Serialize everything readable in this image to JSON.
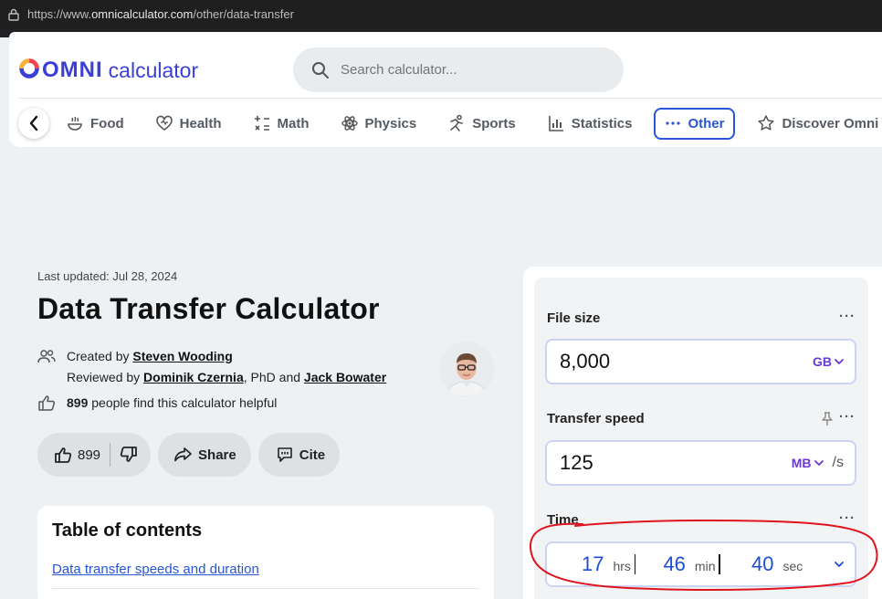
{
  "browser": {
    "url_prefix": "https://www.",
    "url_host": "omnicalculator.com",
    "url_path": "/other/data-transfer"
  },
  "header": {
    "logo_brand": "omni",
    "logo_word": "calculator",
    "search_placeholder": "Search calculator..."
  },
  "nav": {
    "items": [
      {
        "label": "Food",
        "icon": "food-icon"
      },
      {
        "label": "Health",
        "icon": "heart-icon"
      },
      {
        "label": "Math",
        "icon": "math-icon"
      },
      {
        "label": "Physics",
        "icon": "atom-icon"
      },
      {
        "label": "Sports",
        "icon": "runner-icon"
      },
      {
        "label": "Statistics",
        "icon": "bar-chart-icon"
      },
      {
        "label": "Other",
        "icon": "dots-icon",
        "active": true
      },
      {
        "label": "Discover Omni",
        "icon": "star-icon"
      }
    ]
  },
  "article": {
    "updated": "Last updated: Jul 28, 2024",
    "title": "Data Transfer Calculator",
    "created_prefix": "Created by",
    "creator": "Steven Wooding",
    "reviewed_prefix": "Reviewed by",
    "reviewer1": "Dominik Czernia",
    "reviewer_mid": ", PhD and",
    "reviewer2": "Jack Bowater",
    "helpful_count": "899",
    "helpful_text": "people find this calculator helpful"
  },
  "actions": {
    "like_count": "899",
    "share": "Share",
    "cite": "Cite"
  },
  "toc": {
    "title": "Table of contents",
    "first_link": "Data transfer speeds and duration"
  },
  "calculator": {
    "file_size": {
      "label": "File size",
      "value": "8,000",
      "unit": "GB"
    },
    "transfer_speed": {
      "label": "Transfer speed",
      "value": "125",
      "unit": "MB",
      "per": "/s"
    },
    "time": {
      "label": "Time",
      "hours": "17",
      "hours_unit": "hrs",
      "minutes": "46",
      "minutes_unit": "min",
      "seconds": "40",
      "seconds_unit": "sec"
    },
    "menu_dots": "···"
  },
  "colors": {
    "accent": "#2856d6",
    "unit": "#6a38d6",
    "annotation": "#e0141e"
  }
}
